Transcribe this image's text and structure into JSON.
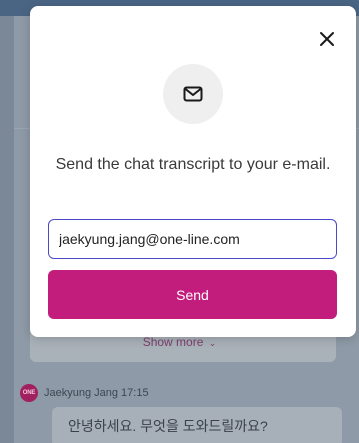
{
  "modal": {
    "message": "Send the chat transcript to your e-mail.",
    "email_value": "jaekyung.jang@one-line.com",
    "email_placeholder": "",
    "send_label": "Send",
    "icons": {
      "close": "close-icon",
      "envelope": "envelope-icon"
    },
    "colors": {
      "send_button": "#c21c7c",
      "input_border": "#4a4ac8"
    }
  },
  "chat": {
    "show_more_label": "Show more",
    "agent_avatar_text": "ONE",
    "agent_meta": "Jaekyung Jang 17:15",
    "agent_message": "안녕하세요. 무엇을 도와드릴까요?",
    "colors": {
      "avatar": "#a12060"
    }
  }
}
